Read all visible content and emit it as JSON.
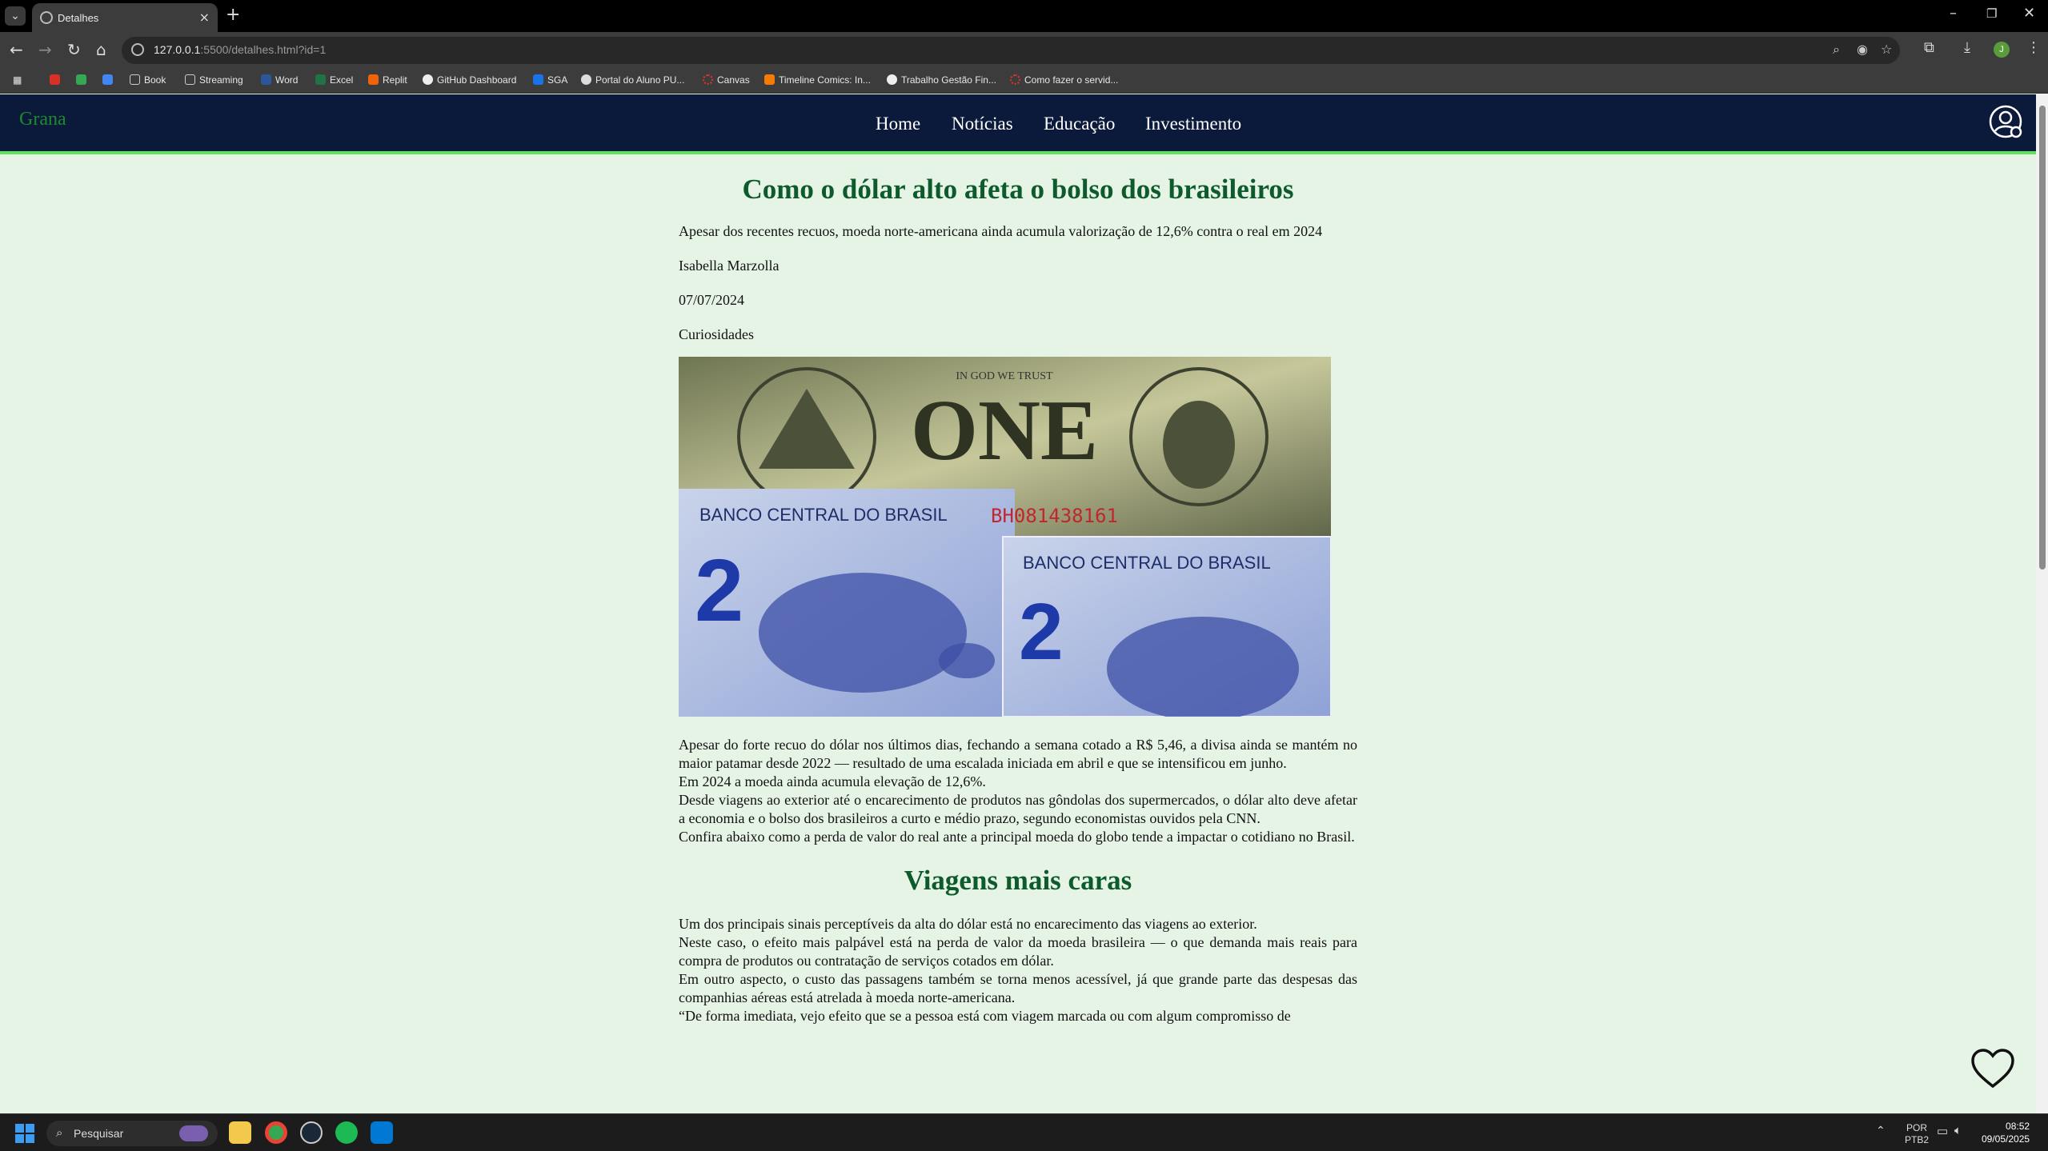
{
  "browser": {
    "tab_title": "Detalhes",
    "url_host": "127.0.0.1",
    "url_rest": ":5500/detalhes.html?id=1",
    "bookmarks": [
      "Book",
      "Streaming",
      "Word",
      "Excel",
      "Replit",
      "GitHub Dashboard",
      "SGA",
      "Portal do Aluno PU...",
      "Canvas",
      "Timeline Comics: In...",
      "Trabalho Gestão Fin...",
      "Como fazer o servid..."
    ],
    "profile_initial": "J"
  },
  "site": {
    "logo": "Grana",
    "nav": [
      "Home",
      "Notícias",
      "Educação",
      "Investimento"
    ]
  },
  "article": {
    "title": "Como o dólar alto afeta o bolso dos brasileiros",
    "subtitle": "Apesar dos recentes recuos, moeda norte-americana ainda acumula valorização de 12,6% contra o real em 2024",
    "author": "Isabella Marzolla",
    "date": "07/07/2024",
    "category": "Curiosidades",
    "image_text": {
      "motto": "IN GOD WE TRUST",
      "denomination": "ONE",
      "bank": "BANCO CENTRAL DO BRASIL",
      "serial": "BH081438161"
    },
    "paragraphs": [
      "Apesar do forte recuo do dólar nos últimos dias, fechando a semana cotado a R$ 5,46, a divisa ainda se mantém no maior patamar desde 2022 — resultado de uma escalada iniciada em abril e que se intensificou em junho.",
      "Em 2024 a moeda ainda acumula elevação de 12,6%.",
      "Desde viagens ao exterior até o encarecimento de produtos nas gôndolas dos supermercados, o dólar alto deve afetar a economia e o bolso dos brasileiros a curto e médio prazo, segundo economistas ouvidos pela CNN.",
      "Confira abaixo como a perda de valor do real ante a principal moeda do globo tende a impactar o cotidiano no Brasil."
    ],
    "section_title": "Viagens mais caras",
    "section_paragraphs": [
      "Um dos principais sinais perceptíveis da alta do dólar está no encarecimento das viagens ao exterior.",
      "Neste caso, o efeito mais palpável está na perda de valor da moeda brasileira — o que demanda mais reais para compra de produtos ou contratação de serviços cotados em dólar.",
      "Em outro aspecto, o custo das passagens também se torna menos acessível, já que grande parte das despesas das companhias aéreas está atrelada à moeda norte-americana.",
      "“De forma imediata, vejo efeito que se a pessoa está com viagem marcada ou com algum compromisso de"
    ]
  },
  "taskbar": {
    "search_placeholder": "Pesquisar",
    "lang_top": "POR",
    "lang_bottom": "PTB2",
    "time": "08:52",
    "date": "09/05/2025"
  }
}
